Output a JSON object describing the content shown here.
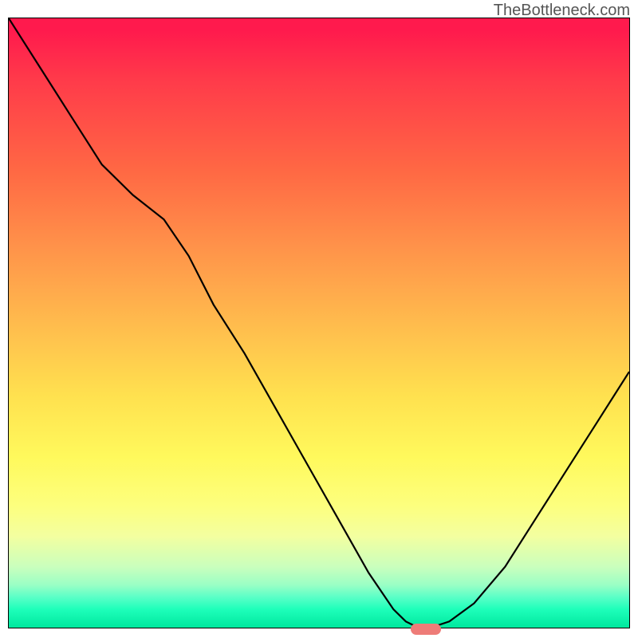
{
  "watermark": "TheBottleneck.com",
  "chart_data": {
    "type": "line",
    "title": "",
    "xlabel": "",
    "ylabel": "",
    "x": [
      0.0,
      0.05,
      0.1,
      0.15,
      0.2,
      0.25,
      0.29,
      0.33,
      0.38,
      0.43,
      0.48,
      0.53,
      0.58,
      0.62,
      0.64,
      0.66,
      0.68,
      0.71,
      0.75,
      0.8,
      0.85,
      0.9,
      0.95,
      1.0
    ],
    "values": [
      1.0,
      0.92,
      0.84,
      0.76,
      0.71,
      0.67,
      0.61,
      0.53,
      0.45,
      0.36,
      0.27,
      0.18,
      0.09,
      0.03,
      0.01,
      0.0,
      0.0,
      0.01,
      0.04,
      0.1,
      0.18,
      0.26,
      0.34,
      0.42
    ],
    "xlim": [
      0,
      1
    ],
    "ylim": [
      0,
      1
    ],
    "marker_x": 0.67,
    "marker_y": 0.0,
    "background_gradient": [
      "#ff1a4d",
      "#ffbb4d",
      "#fff95c",
      "#00e89e"
    ],
    "note": "V-shaped bottleneck curve; minimum near x≈0.67; gradient background encodes severity (red=high, green=optimal)."
  }
}
